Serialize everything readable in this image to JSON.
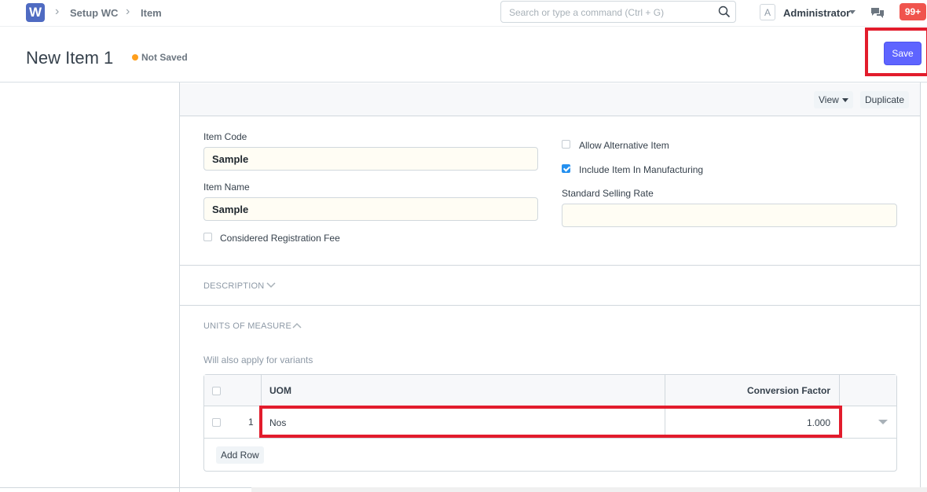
{
  "navbar": {
    "logo_letter": "W",
    "breadcrumbs": [
      "Setup WC",
      "Item"
    ],
    "search_placeholder": "Search or type a command (Ctrl + G)",
    "avatar_letter": "A",
    "user_name": "Administrator",
    "notification_count": "99+"
  },
  "page": {
    "title": "New Item 1",
    "status": "Not Saved",
    "save_label": "Save"
  },
  "toolbar": {
    "view_label": "View",
    "duplicate_label": "Duplicate"
  },
  "form": {
    "item_code_label": "Item Code",
    "item_code_value": "Sample",
    "item_name_label": "Item Name",
    "item_name_value": "Sample",
    "registration_fee_label": "Considered Registration Fee",
    "registration_fee_checked": false,
    "allow_alternative_label": "Allow Alternative Item",
    "allow_alternative_checked": false,
    "include_manufacturing_label": "Include Item In Manufacturing",
    "include_manufacturing_checked": true,
    "standard_selling_rate_label": "Standard Selling Rate",
    "standard_selling_rate_value": ""
  },
  "sections": {
    "description": "DESCRIPTION",
    "uom": "UNITS OF MEASURE",
    "uom_hint": "Will also apply for variants"
  },
  "uom_table": {
    "columns": [
      "UOM",
      "Conversion Factor"
    ],
    "rows": [
      {
        "idx": "1",
        "uom": "Nos",
        "conversion_factor": "1.000"
      }
    ],
    "add_row_label": "Add Row"
  },
  "colors": {
    "primary": "#5e64ff",
    "highlight": "#e21c2c",
    "status_dot": "#ff9f1c",
    "notification": "#f0544d",
    "checkbox_checked": "#2490ef"
  }
}
